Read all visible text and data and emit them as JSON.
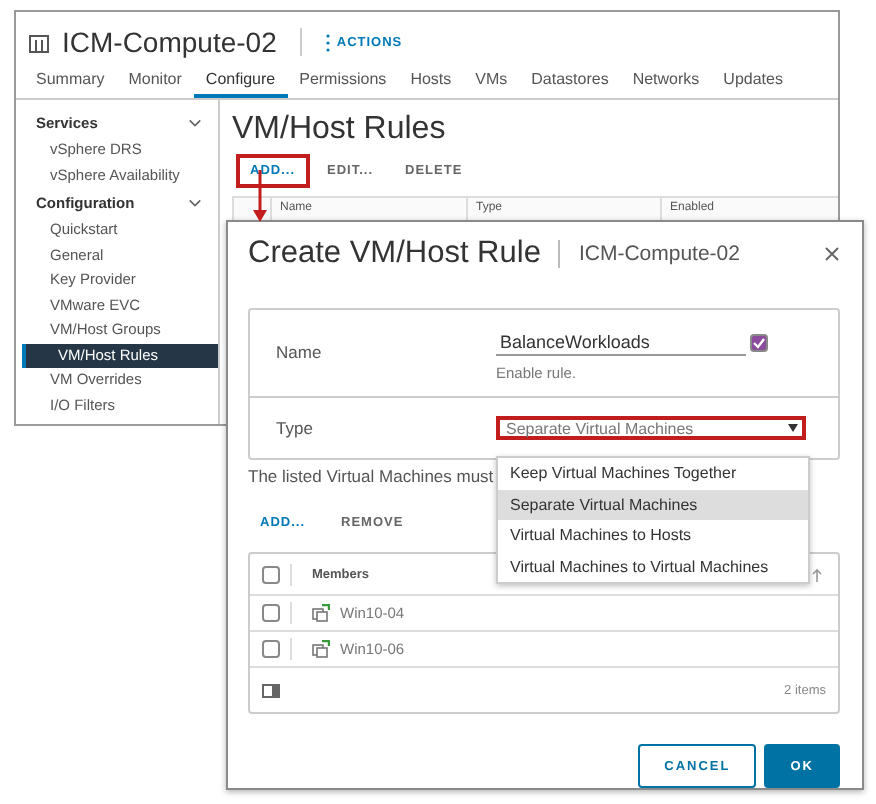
{
  "window": {
    "title": "ICM-Compute-02",
    "actions": "ACTIONS",
    "tabs": [
      {
        "label": "Summary",
        "selected": false
      },
      {
        "label": "Monitor",
        "selected": false
      },
      {
        "label": "Configure",
        "selected": true
      },
      {
        "label": "Permissions",
        "selected": false
      },
      {
        "label": "Hosts",
        "selected": false
      },
      {
        "label": "VMs",
        "selected": false
      },
      {
        "label": "Datastores",
        "selected": false
      },
      {
        "label": "Networks",
        "selected": false
      },
      {
        "label": "Updates",
        "selected": false
      }
    ],
    "sidebar": [
      {
        "title": "Services",
        "expanded": true,
        "items": [
          {
            "label": "vSphere DRS",
            "selected": false
          },
          {
            "label": "vSphere Availability",
            "selected": false
          }
        ]
      },
      {
        "title": "Configuration",
        "expanded": true,
        "items": [
          {
            "label": "Quickstart",
            "selected": false
          },
          {
            "label": "General",
            "selected": false
          },
          {
            "label": "Key Provider",
            "selected": false
          },
          {
            "label": "VMware EVC",
            "selected": false
          },
          {
            "label": "VM/Host Groups",
            "selected": false
          },
          {
            "label": "VM/Host Rules",
            "selected": true
          },
          {
            "label": "VM Overrides",
            "selected": false
          },
          {
            "label": "I/O Filters",
            "selected": false
          }
        ]
      }
    ],
    "heading": "VM/Host Rules",
    "toolbar": [
      "ADD...",
      "EDIT...",
      "DELETE"
    ],
    "columns": [
      "Name",
      "Type",
      "Enabled"
    ]
  },
  "dialog": {
    "title": "Create VM/Host Rule",
    "subtitle": "ICM-Compute-02",
    "name_label": "Name",
    "name_value": "BalanceWorkloads",
    "enable_checked": true,
    "enable_label": "Enable rule.",
    "type_label": "Type",
    "type_value": "Separate Virtual Machines",
    "type_open": true,
    "type_options": [
      {
        "label": "Keep Virtual Machines Together",
        "selected": false
      },
      {
        "label": "Separate Virtual Machines",
        "selected": true
      },
      {
        "label": "Virtual Machines to Hosts",
        "selected": false
      },
      {
        "label": "Virtual Machines to Virtual Machines",
        "selected": false
      }
    ],
    "note": "The listed Virtual Machines must",
    "toolbar": [
      "ADD...",
      "REMOVE"
    ],
    "select_all_checked": false,
    "members_column": "Members",
    "members": [
      {
        "name": "Win10-04",
        "checked": false
      },
      {
        "name": "Win10-06",
        "checked": false
      }
    ],
    "footer_count": "2 items",
    "buttons": [
      {
        "label": "CANCEL",
        "kind": "secondary"
      },
      {
        "label": "OK",
        "kind": "primary"
      }
    ]
  }
}
